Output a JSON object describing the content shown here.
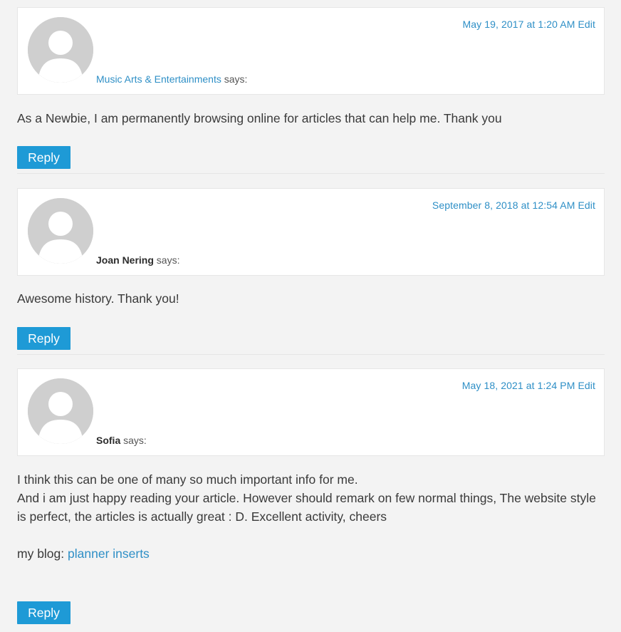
{
  "comments": [
    {
      "date": "May 19, 2017 at 1:20 AM",
      "edit_label": "Edit",
      "author": "Music Arts & Entertainments",
      "author_is_link": true,
      "says": "says:",
      "body": [
        "As a Newbie, I am permanently browsing online for articles that can help me. Thank you"
      ],
      "reply_label": "Reply"
    },
    {
      "date": "September 8, 2018 at 12:54 AM",
      "edit_label": "Edit",
      "author": "Joan Nering",
      "author_is_link": false,
      "says": "says:",
      "body": [
        "Awesome history. Thank you!"
      ],
      "reply_label": "Reply"
    },
    {
      "date": "May 18, 2021 at 1:24 PM",
      "edit_label": "Edit",
      "author": "Sofia",
      "author_is_link": false,
      "says": "says:",
      "body": [
        "I think this can be one of many so much important info for me.",
        "And i am just happy reading your article. However should remark on few normal things, The website style",
        "is perfect, the articles is actually great : D. Excellent activity, cheers"
      ],
      "blog_prefix": "my blog:",
      "blog_link": "planner inserts",
      "reply_label": "Reply"
    }
  ],
  "colors": {
    "link": "#2e8fc6",
    "reply_button": "#1e9ad6",
    "avatar": "#cfcfcf",
    "background": "#f3f3f3"
  },
  "icons": {
    "avatar": "default-avatar-icon"
  }
}
